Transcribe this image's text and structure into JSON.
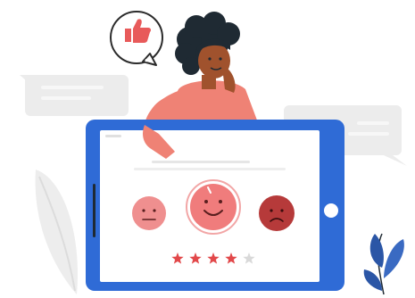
{
  "illustration": {
    "rating": {
      "filled_stars": 4,
      "total_stars": 5
    },
    "emoji_options": [
      {
        "name": "neutral",
        "color": "#ef8f8f"
      },
      {
        "name": "happy",
        "color": "#f07c7c",
        "selected": true
      },
      {
        "name": "unhappy",
        "color": "#b63a3a"
      }
    ],
    "colors": {
      "tablet_frame": "#2f6bd6",
      "accent_red": "#e85a5a",
      "star_filled": "#e2484a",
      "star_empty": "#d9d9d9",
      "skin": "#a0522d",
      "hair": "#1f2a33",
      "shirt": "#ef8275",
      "leaf_blue": "#2b56a6"
    },
    "icons": [
      "thumbs-up-icon",
      "speech-bubble-icon",
      "tablet-icon",
      "star-icon",
      "leaf-icon"
    ]
  }
}
